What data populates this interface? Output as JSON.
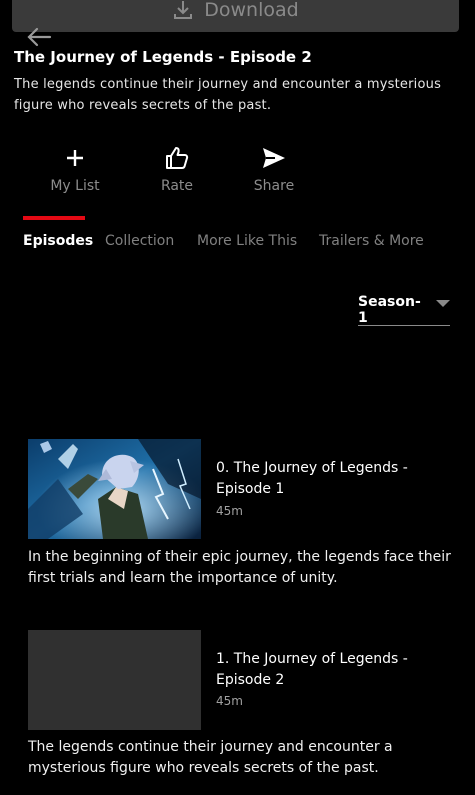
{
  "header": {
    "download_label": "Download",
    "title": "The Journey of Legends - Episode 2",
    "synopsis": "The legends continue their journey and encounter a mysterious figure who reveals secrets of the past."
  },
  "actions": [
    {
      "label": "My List",
      "icon": "plus-icon"
    },
    {
      "label": "Rate",
      "icon": "thumbs-up-icon"
    },
    {
      "label": "Share",
      "icon": "send-icon"
    }
  ],
  "tabs": [
    {
      "label": "Episodes",
      "active": true
    },
    {
      "label": "Collection",
      "active": false
    },
    {
      "label": "More Like This",
      "active": false
    },
    {
      "label": "Trailers & More",
      "active": false
    }
  ],
  "season_selector": {
    "selected": "Season-1"
  },
  "episodes": [
    {
      "title": "0. The Journey of Legends - Episode 1",
      "duration": "45m",
      "description": "In the beginning of their epic journey, the legends face their first trials and learn the importance of unity.",
      "thumbnail": "anime-character-artwork"
    },
    {
      "title": "1. The Journey of Legends - Episode 2",
      "duration": "45m",
      "description": "The legends continue their journey and encounter a mysterious figure who reveals secrets of the past.",
      "thumbnail": "placeholder"
    }
  ],
  "colors": {
    "background": "#000000",
    "accent": "#e50914",
    "muted_text": "#8c8c8c",
    "placeholder": "#303030"
  }
}
